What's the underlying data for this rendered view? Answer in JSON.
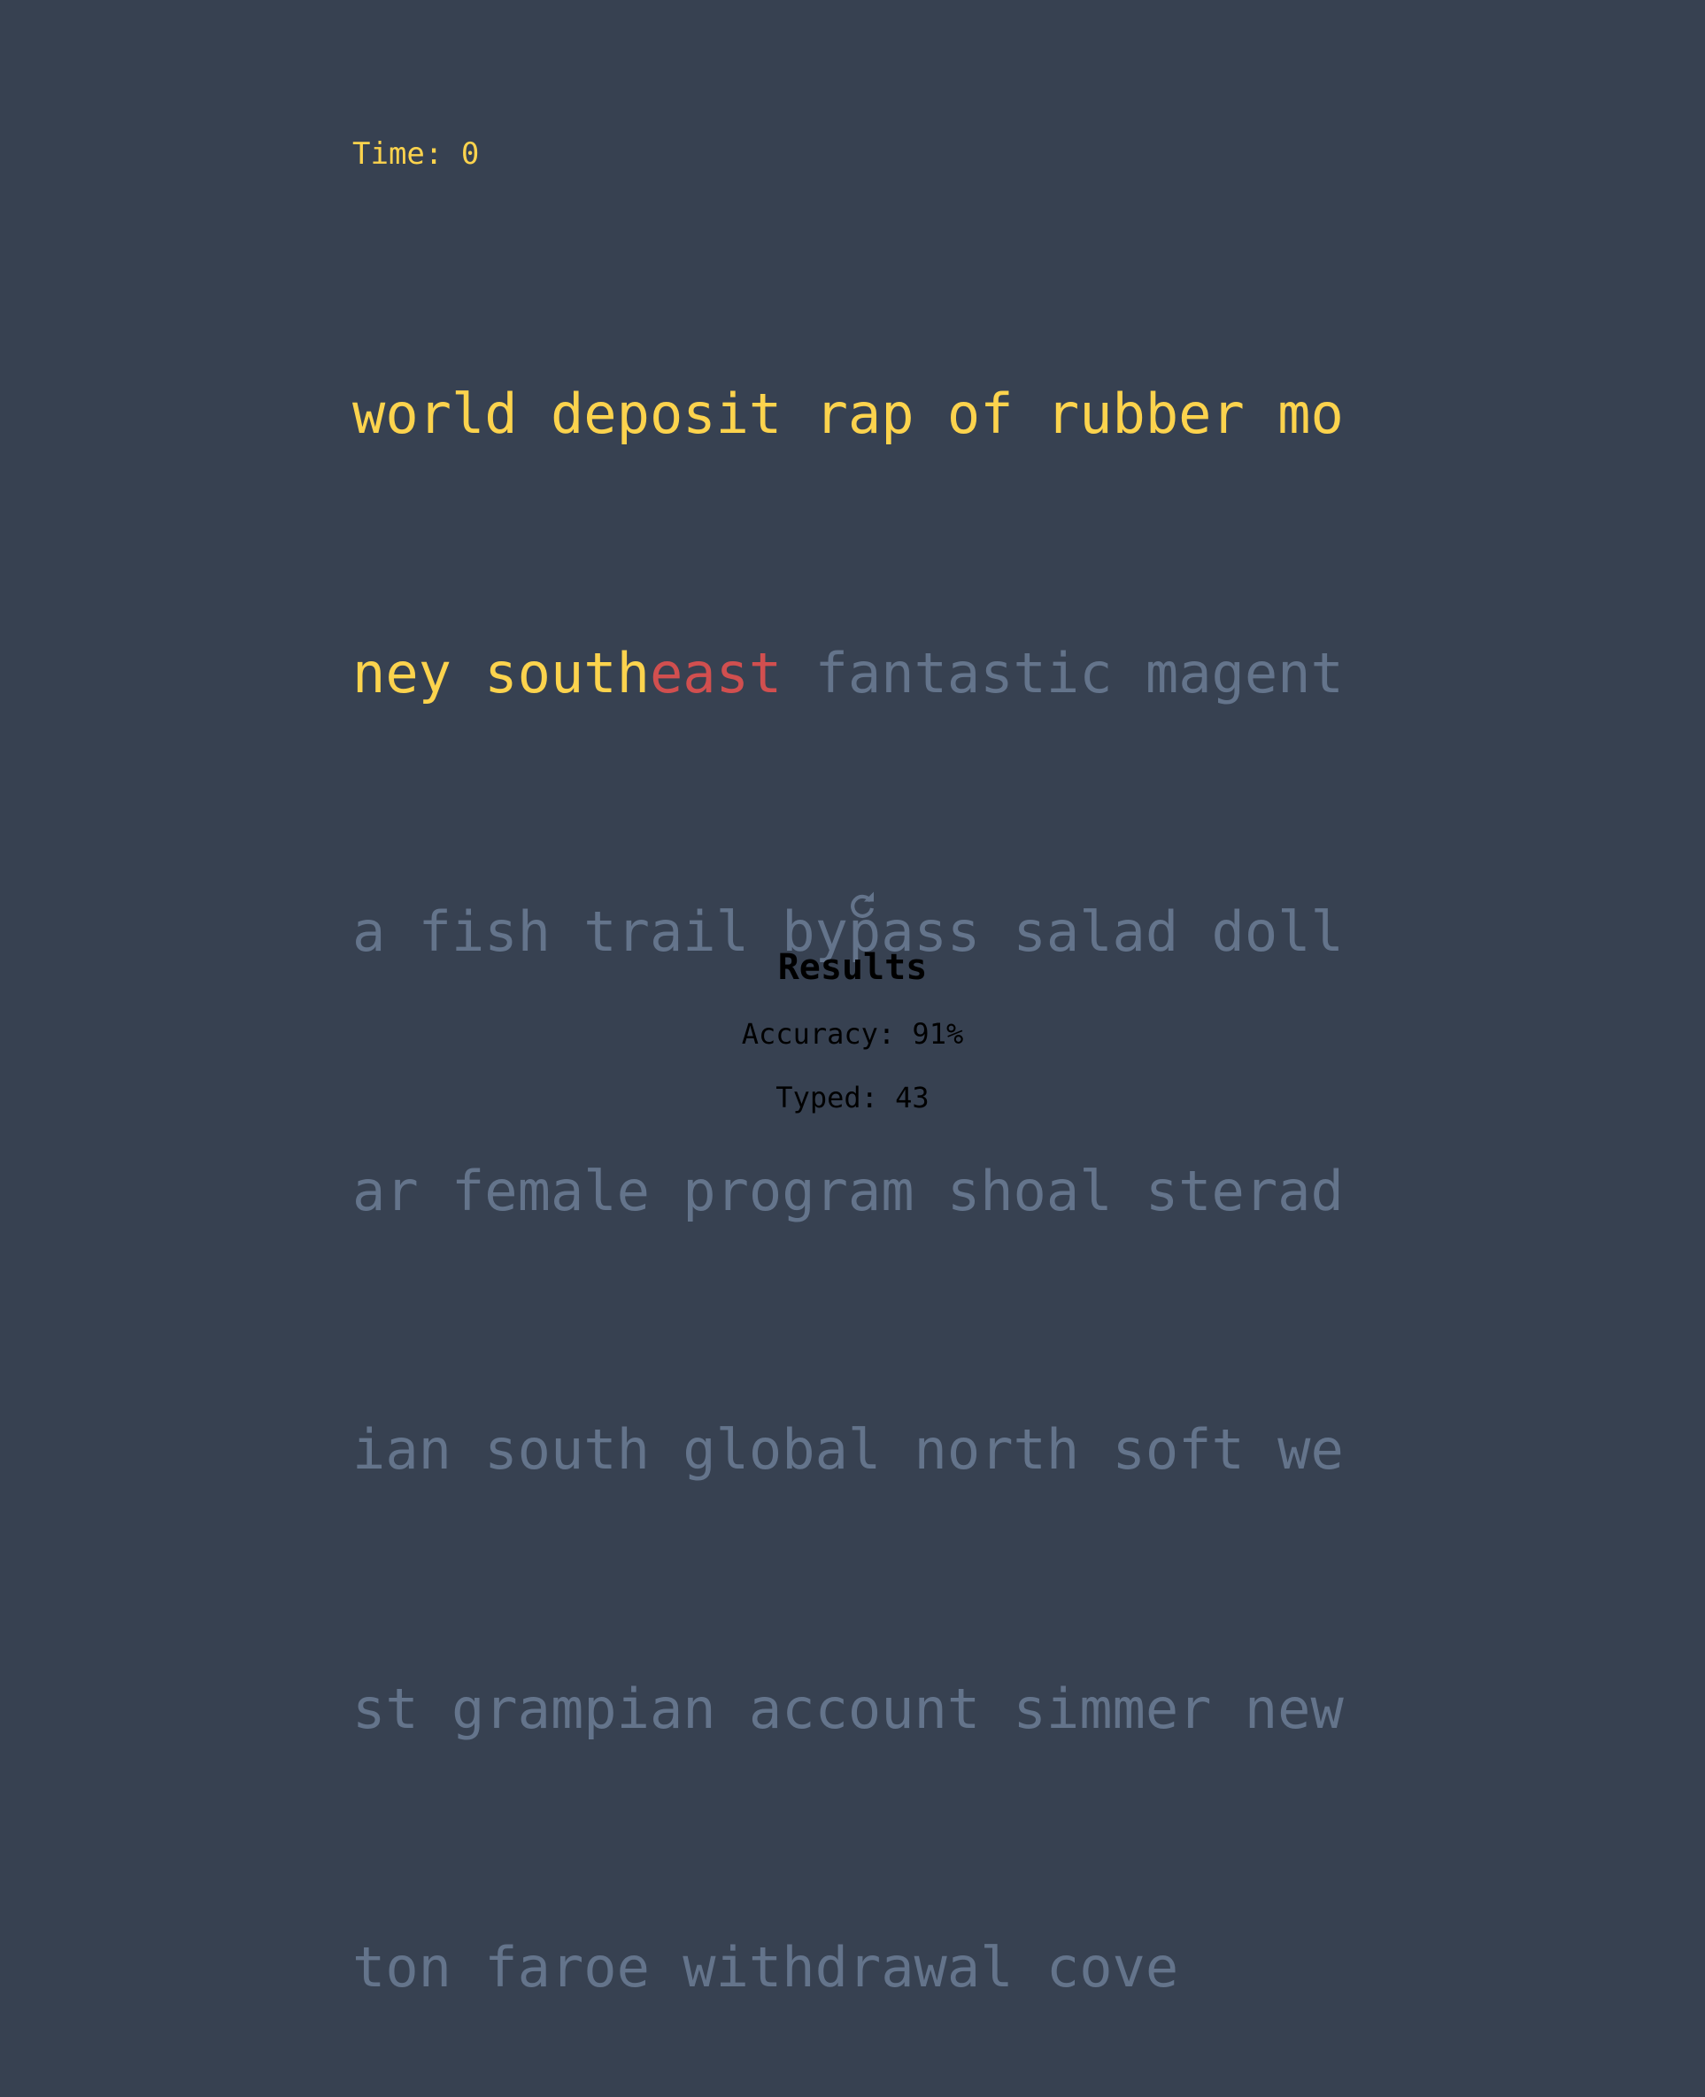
{
  "timer": {
    "label": "Time: 0"
  },
  "text": {
    "lines": [
      {
        "typed": "world deposit rap of rubber mo",
        "error": "",
        "untyped": ""
      },
      {
        "typed": "ney south",
        "error": "east",
        "untyped": " fantastic magent"
      },
      {
        "typed": "",
        "error": "",
        "untyped": "a fish trail bypass salad doll"
      },
      {
        "typed": "",
        "error": "",
        "untyped": "ar female program shoal sterad"
      },
      {
        "typed": "",
        "error": "",
        "untyped": "ian south global north soft we"
      },
      {
        "typed": "",
        "error": "",
        "untyped": "st grampian account simmer new"
      },
      {
        "typed": "",
        "error": "",
        "untyped": "ton faroe withdrawal cove"
      }
    ]
  },
  "restart": {
    "icon": "restart-icon"
  },
  "results": {
    "title": "Results",
    "accuracy": "Accuracy: 91%",
    "typed": "Typed: 43"
  },
  "colors": {
    "background": "#374151",
    "typed": "#fcd34d",
    "error": "#d14f4f",
    "untyped": "#64748b",
    "results_text": "#000000"
  }
}
